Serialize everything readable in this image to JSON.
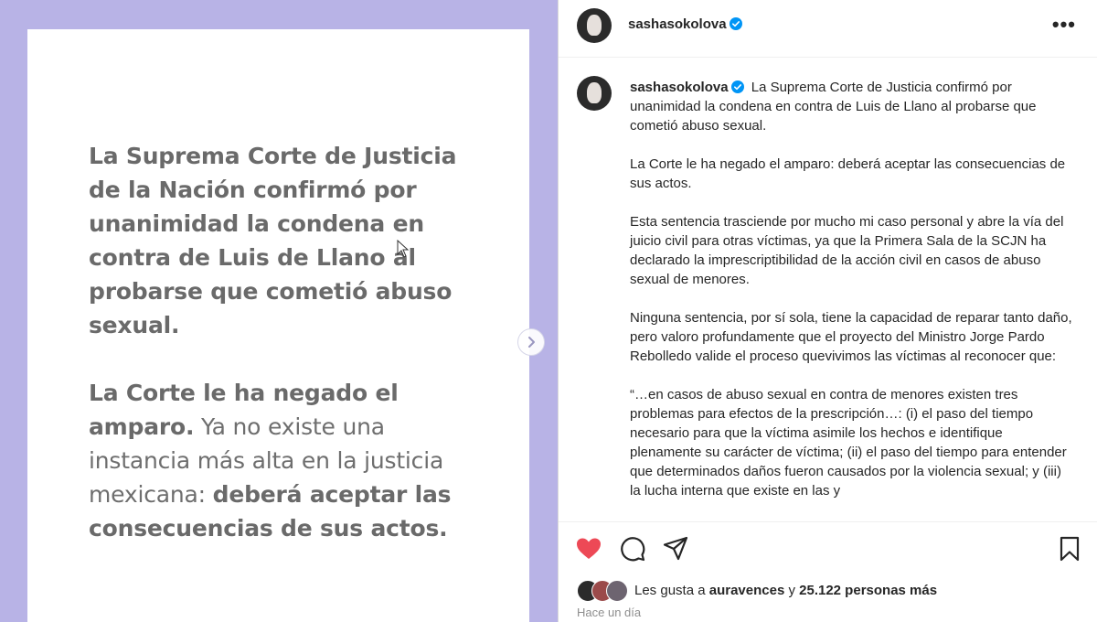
{
  "post_image": {
    "background_color": "#b8b3e6",
    "paragraph1_bold": "La Suprema Corte de Justicia de la Nación confirmó por unanimidad la condena en contra de Luis de Llano al probarse que cometió abuso sexual.",
    "paragraph2_bold_a": "La Corte le ha negado el amparo.",
    "paragraph2_regular": " Ya no existe una instancia más alta en la justicia mexicana: ",
    "paragraph2_bold_b": "deberá aceptar las consecuencias de sus actos."
  },
  "header": {
    "username": "sashasokolova",
    "more_icon": "more-horizontal-icon"
  },
  "caption": {
    "username": "sashasokolova",
    "paragraphs": [
      "La Suprema Corte de Justicia confirmó por unanimidad la condena en contra de Luis de Llano al probarse que cometió abuso sexual.",
      "La Corte le ha negado el amparo: deberá aceptar las consecuencias de sus actos.",
      "Esta sentencia trasciende por mucho mi caso personal y abre la vía del juicio civil para otras víctimas, ya que la Primera Sala de la SCJN ha declarado la imprescriptibilidad de la acción civil en casos de abuso sexual de menores.",
      "Ninguna sentencia, por sí sola, tiene la capacidad de reparar tanto daño, pero valoro profundamente que el proyecto del Ministro Jorge Pardo Rebolledo valide el proceso quevivimos las víctimas al reconocer que:",
      "“…en casos de abuso sexual en contra de menores existen tres problemas para efectos de la prescripción…: (i) el paso del tiempo necesario para que la víctima asimile los hechos e identifique plenamente su carácter de víctima; (ii) el paso del tiempo para entender que determinados daños fueron causados por la violencia sexual; y (iii) la lucha interna que existe en las y"
    ]
  },
  "actions": {
    "like_color": "#ed4956",
    "icons": [
      "heart-filled-icon",
      "comment-icon",
      "share-icon",
      "bookmark-icon"
    ]
  },
  "likes": {
    "prefix": "Les gusta a ",
    "user": "auravences",
    "connector": " y ",
    "count": "25.122 personas más"
  },
  "timestamp": "Hace un día",
  "colors": {
    "verified": "#0095f6",
    "text": "#262626",
    "muted": "#8e8e8e"
  }
}
